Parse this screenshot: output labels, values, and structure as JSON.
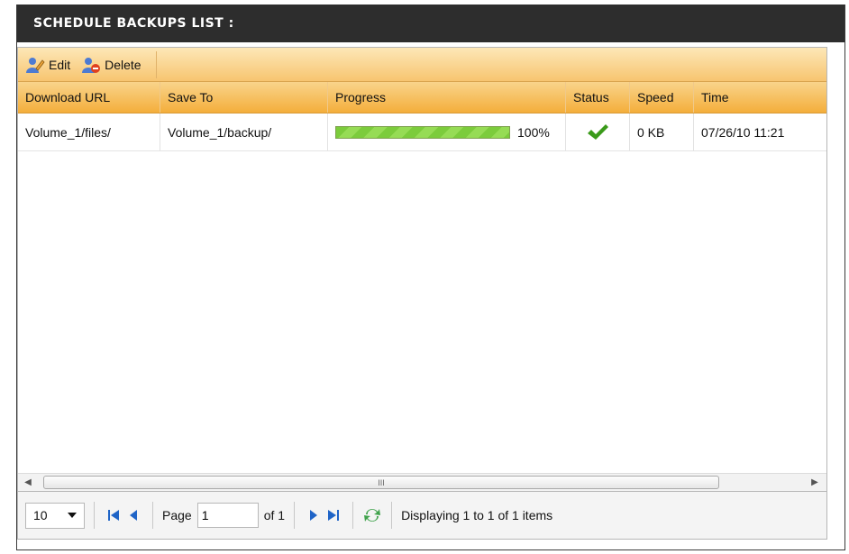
{
  "panel": {
    "title": "SCHEDULE BACKUPS LIST :"
  },
  "toolbar": {
    "edit_label": "Edit",
    "delete_label": "Delete"
  },
  "table": {
    "columns": [
      "Download URL",
      "Save To",
      "Progress",
      "Status",
      "Speed",
      "Time"
    ],
    "rows": [
      {
        "download_url": "Volume_1/files/",
        "save_to": "Volume_1/backup/",
        "progress": 1.0,
        "progress_text": "100%",
        "status": "check-icon",
        "speed": "0 KB",
        "time": "07/26/10 11:21"
      }
    ]
  },
  "scrollbar": {
    "thumb_grip": "III"
  },
  "pager": {
    "page_size": "10",
    "page_label": "Page",
    "page_value": "1",
    "of_label": "of 1",
    "display_text": "Displaying 1 to 1 of 1 items"
  },
  "colors": {
    "header_bg": "#2d2d2d",
    "toolbar_bg": "#f7c570",
    "column_header_bg": "#f4ae3b",
    "progress_fill": "#7ccc3c",
    "status_check": "#3a9a1a",
    "pager_icon_blue": "#1f64c7",
    "refresh_green": "#3fa24b"
  }
}
